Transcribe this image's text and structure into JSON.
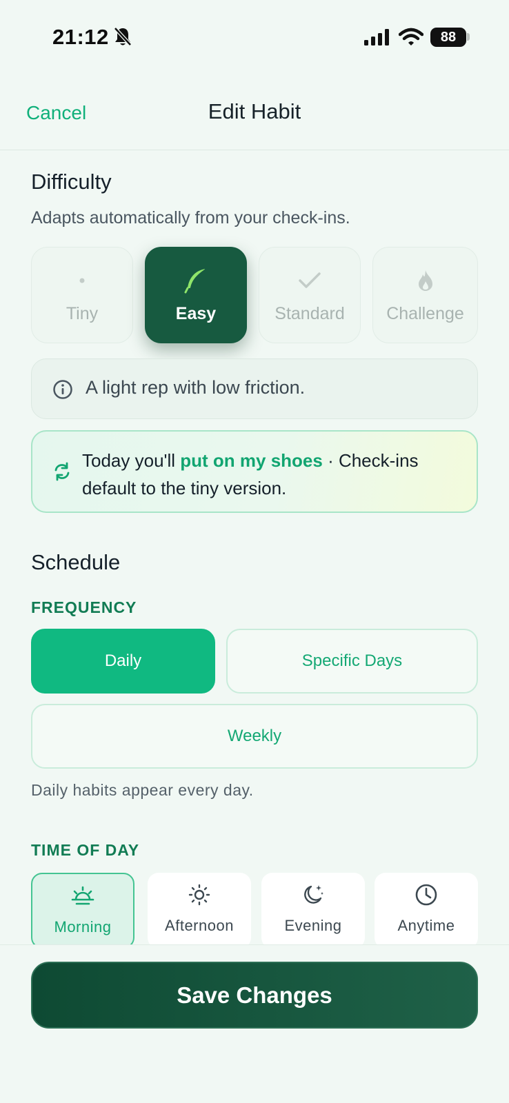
{
  "status_bar": {
    "time": "21:12",
    "battery": "88"
  },
  "nav": {
    "cancel_label": "Cancel",
    "title": "Edit Habit"
  },
  "difficulty": {
    "title": "Difficulty",
    "subtitle": "Adapts automatically from your check-ins.",
    "options": [
      {
        "label": "Tiny",
        "icon": "dot-icon",
        "selected": false
      },
      {
        "label": "Easy",
        "icon": "feather-icon",
        "selected": true
      },
      {
        "label": "Standard",
        "icon": "check-icon",
        "selected": false
      },
      {
        "label": "Challenge",
        "icon": "flame-icon",
        "selected": false
      }
    ],
    "info_text": "A light rep with low friction.",
    "today": {
      "prefix": "Today you'll ",
      "highlight": "put on my shoes",
      "suffix": " · Check-ins default to the tiny version."
    }
  },
  "schedule": {
    "title": "Schedule",
    "frequency_label": "FREQUENCY",
    "frequency_options": [
      {
        "label": "Daily",
        "selected": true
      },
      {
        "label": "Specific Days",
        "selected": false
      },
      {
        "label": "Weekly",
        "selected": false
      }
    ],
    "frequency_note": "Daily habits appear every day.",
    "time_of_day_label": "TIME OF DAY",
    "time_of_day_options": [
      {
        "label": "Morning",
        "icon": "sunrise-icon",
        "selected": true
      },
      {
        "label": "Afternoon",
        "icon": "sun-icon",
        "selected": false
      },
      {
        "label": "Evening",
        "icon": "moon-icon",
        "selected": false
      },
      {
        "label": "Anytime",
        "icon": "clock-icon",
        "selected": false
      }
    ]
  },
  "footer": {
    "save_label": "Save Changes"
  },
  "colors": {
    "accent": "#10b981",
    "dark_green": "#175a40",
    "background": "#f1f8f4"
  }
}
